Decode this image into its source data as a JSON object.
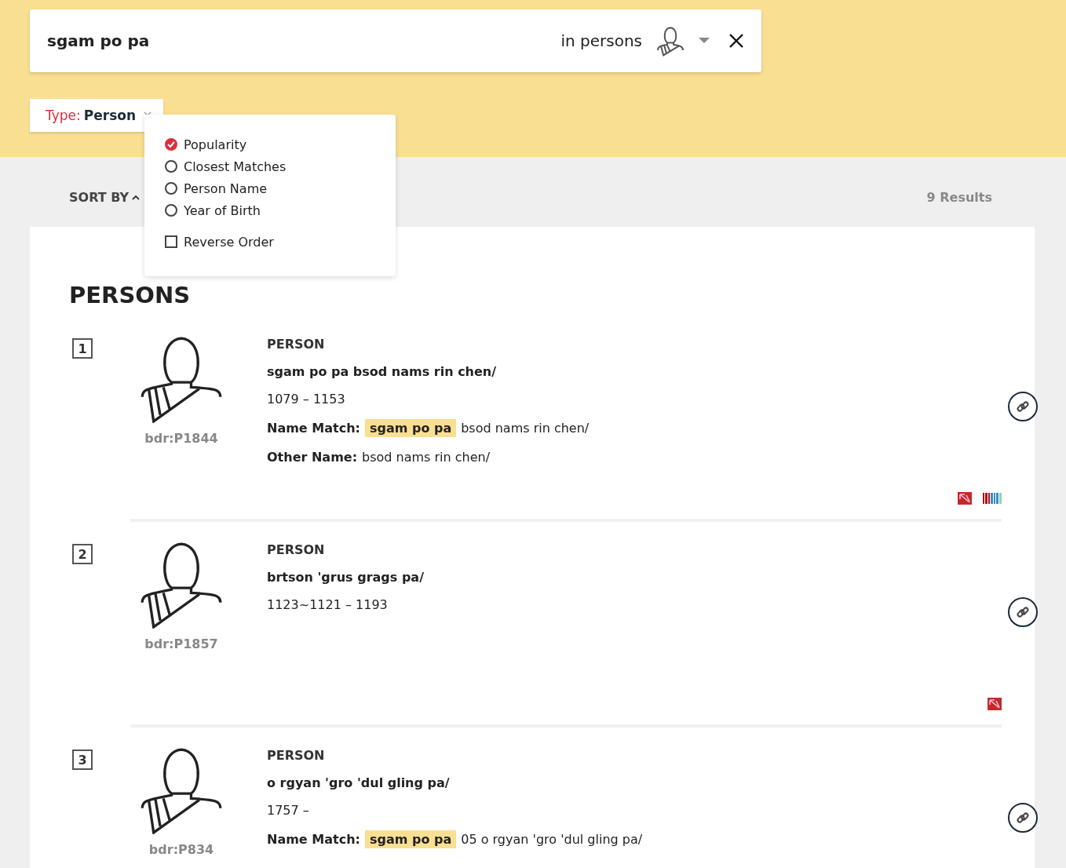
{
  "search": {
    "value": "sgam po pa",
    "scope": "in persons"
  },
  "filter": {
    "label": "Type:",
    "value": "Person"
  },
  "sort": {
    "label": "SORT BY",
    "expanded": true,
    "options": [
      {
        "label": "Popularity",
        "selected": true
      },
      {
        "label": "Closest Matches",
        "selected": false
      },
      {
        "label": "Person Name",
        "selected": false
      },
      {
        "label": "Year of Birth",
        "selected": false
      }
    ],
    "reverse": {
      "label": "Reverse Order",
      "checked": false
    }
  },
  "results_count": "9 Results",
  "section_title": "PERSONS",
  "results": [
    {
      "number": "1",
      "id": "bdr:P1844",
      "type": "PERSON",
      "name": "sgam po pa bsod nams rin chen/",
      "dates": "1079 – 1153",
      "fields": [
        {
          "label": "Name Match:",
          "highlight": "sgam po pa",
          "text": "bsod nams rin chen/"
        },
        {
          "label": "Other Name:",
          "text": "bsod nams rin chen/"
        }
      ],
      "sources": [
        {
          "kind": "slash"
        },
        {
          "kind": "stripes"
        }
      ]
    },
    {
      "number": "2",
      "id": "bdr:P1857",
      "type": "PERSON",
      "name": "brtson 'grus grags pa/",
      "dates": "1123~1121 – 1193",
      "sources": [
        {
          "kind": "slash"
        }
      ]
    },
    {
      "number": "3",
      "id": "bdr:P834",
      "type": "PERSON",
      "name": "o rgyan 'gro 'dul gling pa/",
      "dates": "1757 –",
      "fields": [
        {
          "label": "Name Match:",
          "highlight": "sgam po pa",
          "text": "05 o rgyan 'gro 'dul gling pa/"
        }
      ]
    }
  ]
}
